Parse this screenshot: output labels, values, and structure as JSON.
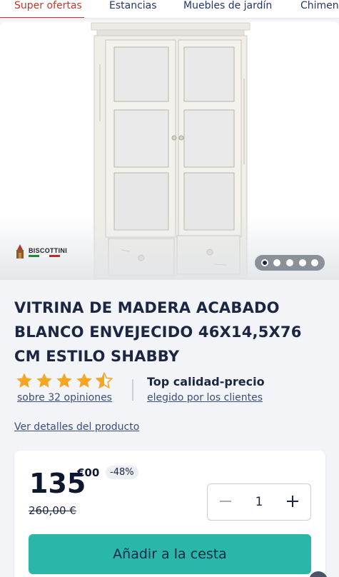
{
  "nav": {
    "items": [
      {
        "label": "Super ofertas",
        "active": true
      },
      {
        "label": "Estancias",
        "active": false
      },
      {
        "label": "Muebles de jardín",
        "active": false
      },
      {
        "label": "Chimen",
        "active": false
      }
    ]
  },
  "gallery": {
    "brand": "BISCOTTINI",
    "slide_count": 5,
    "active_slide": 1
  },
  "product": {
    "title_lines": [
      "VITRINA DE MADERA ACABADO",
      "BLANCO ENVEJECIDO 46X14,5X76",
      "CM ESTILO SHABBY"
    ],
    "rating": 4.5,
    "rating_max": 5,
    "reviews_label": "sobre 32 opiniones",
    "quality_title": "Top calidad-precio",
    "quality_sub": "elegido por los clientes",
    "details_link": "Ver detalles del producto"
  },
  "price": {
    "integer": "135",
    "decimal": "€00",
    "discount": "-48%",
    "old_price": "260,00 €"
  },
  "quantity": {
    "value": "1",
    "minus_icon": "minus-icon",
    "plus_icon": "plus-icon"
  },
  "cart": {
    "add_label": "Añadir a la cesta"
  },
  "colors": {
    "accent": "#c0392b",
    "cta": "#2bb7a7",
    "star": "#f5a623",
    "navy": "#1c2541"
  }
}
